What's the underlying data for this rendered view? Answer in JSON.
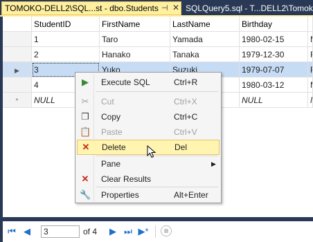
{
  "tabs": {
    "active_title": "TOMOKO-DELL2\\SQL...st - dbo.Students",
    "inactive_title": "SQLQuery5.sql - T...DELL2\\Tomoko"
  },
  "grid": {
    "columns": [
      "StudentID",
      "FirstName",
      "LastName",
      "Birthday"
    ],
    "rows": [
      {
        "id": "1",
        "first": "Taro",
        "last": "Yamada",
        "birthday": "1980-02-15",
        "extra": "M"
      },
      {
        "id": "2",
        "first": "Hanako",
        "last": "Tanaka",
        "birthday": "1979-12-30",
        "extra": "F"
      },
      {
        "id": "3",
        "first": "Yuko",
        "last": "Suzuki",
        "birthday": "1979-07-07",
        "extra": "F"
      },
      {
        "id": "4",
        "first": "",
        "last": "",
        "birthday": "1980-03-12",
        "extra": "M"
      }
    ],
    "new_row": {
      "id": "NULL",
      "birthday": "NULL",
      "extra": "N"
    }
  },
  "navigator": {
    "current_page": "3",
    "page_count": "of 4"
  },
  "context_menu": {
    "items": [
      {
        "label": "Execute SQL",
        "shortcut": "Ctrl+R"
      },
      {
        "label": "Cut",
        "shortcut": "Ctrl+X"
      },
      {
        "label": "Copy",
        "shortcut": "Ctrl+C"
      },
      {
        "label": "Paste",
        "shortcut": "Ctrl+V"
      },
      {
        "label": "Delete",
        "shortcut": "Del"
      },
      {
        "label": "Pane",
        "shortcut": ""
      },
      {
        "label": "Clear Results",
        "shortcut": ""
      },
      {
        "label": "Properties",
        "shortcut": "Alt+Enter"
      }
    ]
  },
  "colors": {
    "tab_highlight": "#fff0a0",
    "window_frame": "#293955",
    "selected_row": "#c6dcf5",
    "menu_hover": "#fff4b0",
    "delete_icon": "#c42b1c",
    "nav_blue": "#1c6fc9"
  },
  "icons": {
    "execute": "execute-sql-icon",
    "cut": "scissors-icon",
    "copy": "copy-icon",
    "paste": "paste-icon",
    "delete": "delete-x-icon",
    "clear": "clear-results-icon",
    "properties": "wrench-icon"
  }
}
